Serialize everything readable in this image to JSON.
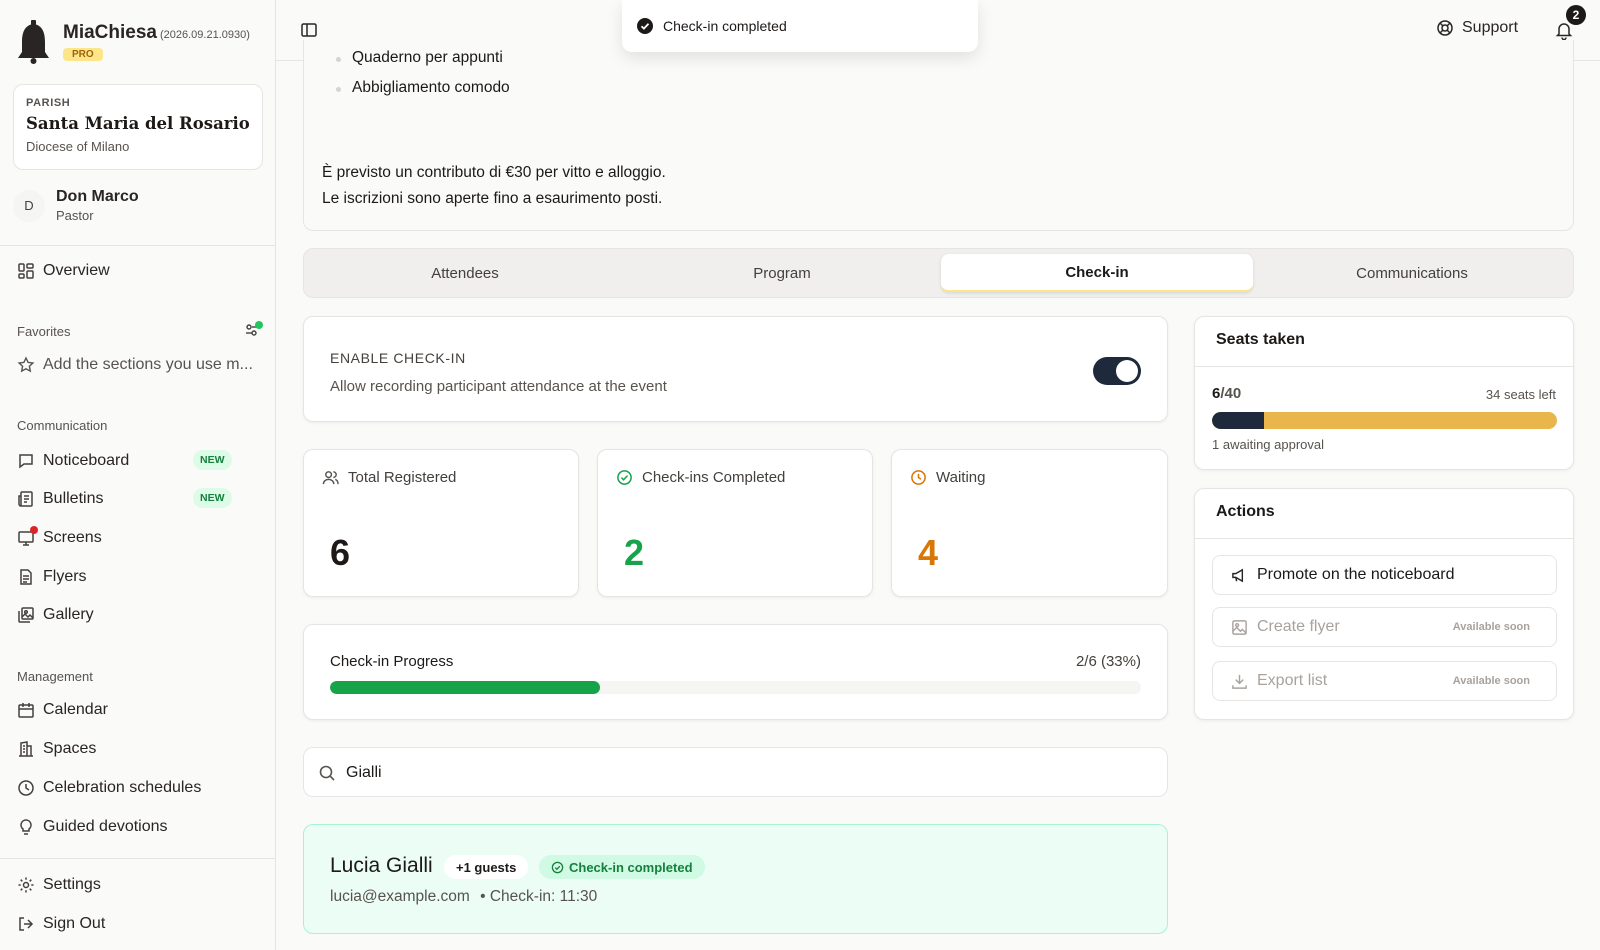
{
  "app": {
    "name": "MiaChiesa",
    "version": "(2026.09.21.0930)",
    "plan_badge": "PRO"
  },
  "parish": {
    "kicker": "PARISH",
    "name": "Santa Maria del Rosario",
    "diocese": "Diocese of Milano"
  },
  "user": {
    "initial": "D",
    "name": "Don Marco",
    "role": "Pastor"
  },
  "sidebar": {
    "overview": "Overview",
    "favorites_title": "Favorites",
    "favorites_hint": "Add the sections you use m...",
    "communication_title": "Communication",
    "communication": [
      {
        "label": "Noticeboard",
        "badge": "NEW"
      },
      {
        "label": "Bulletins",
        "badge": "NEW"
      },
      {
        "label": "Screens"
      },
      {
        "label": "Flyers"
      },
      {
        "label": "Gallery"
      }
    ],
    "management_title": "Management",
    "management": [
      {
        "label": "Calendar"
      },
      {
        "label": "Spaces"
      },
      {
        "label": "Celebration schedules"
      },
      {
        "label": "Guided devotions"
      }
    ],
    "settings": "Settings",
    "sign_out": "Sign Out"
  },
  "topbar": {
    "support": "Support",
    "notification_count": "2"
  },
  "toast": {
    "message": "Check-in completed"
  },
  "description": {
    "bullet_partial": "Quaderno per appunti",
    "bullet": "Abbigliamento comodo",
    "line1": "È previsto un contributo di €30 per vitto e alloggio.",
    "line2": "Le iscrizioni sono aperte fino a esaurimento posti."
  },
  "tabs": [
    "Attendees",
    "Program",
    "Check-in",
    "Communications"
  ],
  "active_tab": "Check-in",
  "checkin": {
    "enable_title": "ENABLE CHECK-IN",
    "enable_desc": "Allow recording participant attendance at the event",
    "enabled": true
  },
  "stats": {
    "total_label": "Total Registered",
    "total_value": "6",
    "completed_label": "Check-ins Completed",
    "completed_value": "2",
    "waiting_label": "Waiting",
    "waiting_value": "4"
  },
  "progress": {
    "label": "Check-in Progress",
    "count": "2/6 (33%)",
    "fraction": 0.333
  },
  "search": {
    "value": "Gialli"
  },
  "attendee": {
    "name": "Lucia Gialli",
    "guests": "+1 guests",
    "status": "Check-in completed",
    "email": "lucia@example.com",
    "checkin_time": "• Check-in: 11:30"
  },
  "seats": {
    "title": "Seats taken",
    "taken": "6",
    "total": "/40",
    "left": "34 seats left",
    "fraction": 0.15,
    "note": "1 awaiting approval"
  },
  "actions": {
    "title": "Actions",
    "items": [
      {
        "label": "Promote on the noticeboard"
      },
      {
        "label": "Create flyer",
        "note": "Available soon"
      },
      {
        "label": "Export list",
        "note": "Available soon"
      }
    ]
  },
  "colors": {
    "accent_green": "#16a34a",
    "accent_amber": "#d97706",
    "dark": "#1e293b",
    "seat_bar": "#e9b64c"
  }
}
